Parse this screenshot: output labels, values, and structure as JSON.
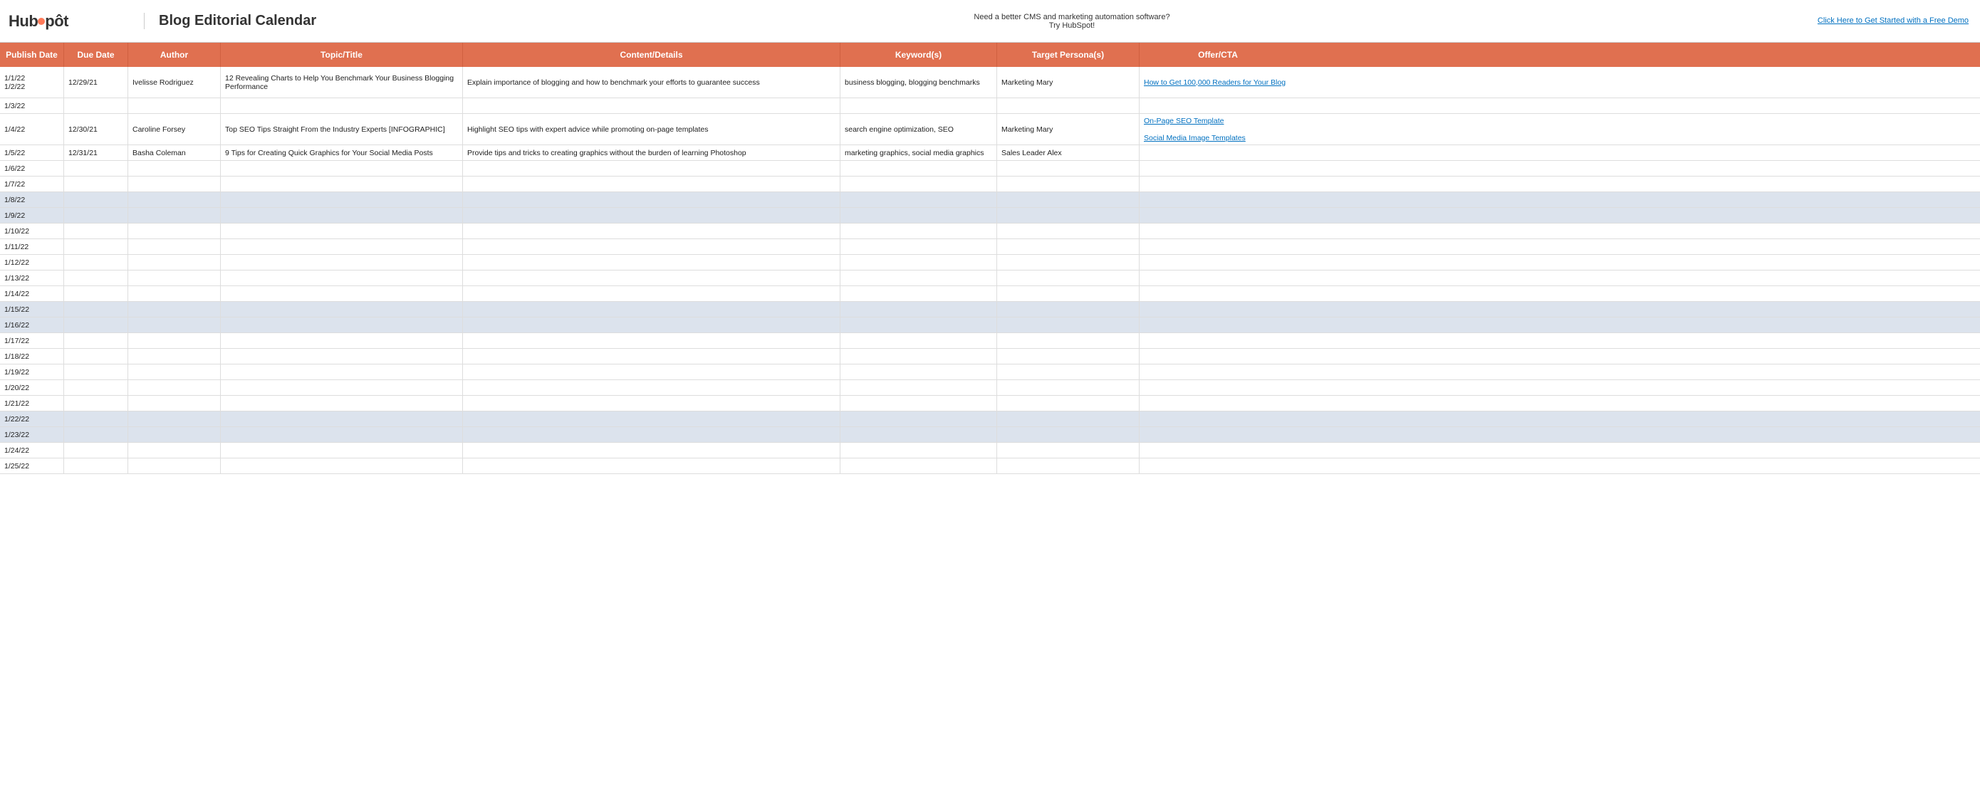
{
  "header": {
    "logo": "HubSpot",
    "title": "Blog Editorial Calendar",
    "promo_line1": "Need a better CMS and marketing automation software?",
    "promo_line2": "Try HubSpot!",
    "cta_text": "Click Here to Get Started with a Free Demo",
    "cta_url": "#"
  },
  "columns": [
    "Publish Date",
    "Due Date",
    "Author",
    "Topic/Title",
    "Content/Details",
    "Keyword(s)",
    "Target Persona(s)",
    "Offer/CTA"
  ],
  "rows": [
    {
      "date": "1/1/22",
      "due": "12/29/21",
      "author": "Ivelisse Rodriguez",
      "topic": "12 Revealing Charts to Help You Benchmark Your Business Blogging Performance",
      "details": "Explain importance of blogging and how to benchmark your efforts to guarantee success",
      "keywords": "business blogging, blogging benchmarks",
      "persona": "Marketing Mary",
      "offer": "How to Get 100,000 Readers for Your Blog",
      "offer_link": true,
      "shaded": false,
      "extra_dates": [
        "1/2/22"
      ]
    },
    {
      "date": "1/3/22",
      "due": "",
      "author": "",
      "topic": "",
      "details": "",
      "keywords": "",
      "persona": "",
      "offer": "",
      "shaded": false,
      "extra_dates": []
    },
    {
      "date": "1/4/22",
      "due": "12/30/21",
      "author": "Caroline Forsey",
      "topic": "Top SEO Tips Straight From the Industry Experts [INFOGRAPHIC]",
      "details": "Highlight SEO tips with expert advice while promoting on-page templates",
      "keywords": "search engine optimization, SEO",
      "persona": "Marketing Mary",
      "offer": "On-Page SEO Template",
      "offer_link": true,
      "shaded": false,
      "extra_dates": []
    },
    {
      "date": "1/5/22",
      "due": "12/31/21",
      "author": "Basha Coleman",
      "topic": "9 Tips for Creating Quick Graphics for Your Social Media Posts",
      "details": "Provide tips and tricks to creating graphics without the burden of learning Photoshop",
      "keywords": "marketing graphics, social media graphics",
      "persona": "Sales Leader Alex",
      "offer": "Social Media Image Templates",
      "offer_link": true,
      "shaded": false,
      "extra_dates": []
    },
    {
      "date": "1/6/22",
      "due": "",
      "author": "",
      "topic": "",
      "details": "",
      "keywords": "",
      "persona": "",
      "offer": "",
      "shaded": false
    },
    {
      "date": "1/7/22",
      "due": "",
      "author": "",
      "topic": "",
      "details": "",
      "keywords": "",
      "persona": "",
      "offer": "",
      "shaded": false
    },
    {
      "date": "1/8/22",
      "due": "",
      "author": "",
      "topic": "",
      "details": "",
      "keywords": "",
      "persona": "",
      "offer": "",
      "shaded": true
    },
    {
      "date": "1/9/22",
      "due": "",
      "author": "",
      "topic": "",
      "details": "",
      "keywords": "",
      "persona": "",
      "offer": "",
      "shaded": true
    },
    {
      "date": "1/10/22",
      "due": "",
      "author": "",
      "topic": "",
      "details": "",
      "keywords": "",
      "persona": "",
      "offer": "",
      "shaded": false
    },
    {
      "date": "1/11/22",
      "due": "",
      "author": "",
      "topic": "",
      "details": "",
      "keywords": "",
      "persona": "",
      "offer": "",
      "shaded": false
    },
    {
      "date": "1/12/22",
      "due": "",
      "author": "",
      "topic": "",
      "details": "",
      "keywords": "",
      "persona": "",
      "offer": "",
      "shaded": false
    },
    {
      "date": "1/13/22",
      "due": "",
      "author": "",
      "topic": "",
      "details": "",
      "keywords": "",
      "persona": "",
      "offer": "",
      "shaded": false
    },
    {
      "date": "1/14/22",
      "due": "",
      "author": "",
      "topic": "",
      "details": "",
      "keywords": "",
      "persona": "",
      "offer": "",
      "shaded": false
    },
    {
      "date": "1/15/22",
      "due": "",
      "author": "",
      "topic": "",
      "details": "",
      "keywords": "",
      "persona": "",
      "offer": "",
      "shaded": true
    },
    {
      "date": "1/16/22",
      "due": "",
      "author": "",
      "topic": "",
      "details": "",
      "keywords": "",
      "persona": "",
      "offer": "",
      "shaded": true
    },
    {
      "date": "1/17/22",
      "due": "",
      "author": "",
      "topic": "",
      "details": "",
      "keywords": "",
      "persona": "",
      "offer": "",
      "shaded": false
    },
    {
      "date": "1/18/22",
      "due": "",
      "author": "",
      "topic": "",
      "details": "",
      "keywords": "",
      "persona": "",
      "offer": "",
      "shaded": false
    },
    {
      "date": "1/19/22",
      "due": "",
      "author": "",
      "topic": "",
      "details": "",
      "keywords": "",
      "persona": "",
      "offer": "",
      "shaded": false
    },
    {
      "date": "1/20/22",
      "due": "",
      "author": "",
      "topic": "",
      "details": "",
      "keywords": "",
      "persona": "",
      "offer": "",
      "shaded": false
    },
    {
      "date": "1/21/22",
      "due": "",
      "author": "",
      "topic": "",
      "details": "",
      "keywords": "",
      "persona": "",
      "offer": "",
      "shaded": false
    },
    {
      "date": "1/22/22",
      "due": "",
      "author": "",
      "topic": "",
      "details": "",
      "keywords": "",
      "persona": "",
      "offer": "",
      "shaded": true
    },
    {
      "date": "1/23/22",
      "due": "",
      "author": "",
      "topic": "",
      "details": "",
      "keywords": "",
      "persona": "",
      "offer": "",
      "shaded": true
    },
    {
      "date": "1/24/22",
      "due": "",
      "author": "",
      "topic": "",
      "details": "",
      "keywords": "",
      "persona": "",
      "offer": "",
      "shaded": false
    },
    {
      "date": "1/25/22",
      "due": "",
      "author": "",
      "topic": "",
      "details": "",
      "keywords": "",
      "persona": "",
      "offer": "",
      "shaded": false
    }
  ]
}
